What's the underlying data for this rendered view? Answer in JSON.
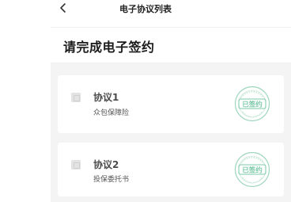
{
  "navbar": {
    "title": "电子协议列表",
    "back_icon": "chevron-left-icon"
  },
  "heading": "请完成电子签约",
  "agreements": [
    {
      "title": "协议1",
      "subtitle": "众包保障险",
      "stamp_text": "已签约",
      "signed": true
    },
    {
      "title": "协议2",
      "subtitle": "投保委托书",
      "stamp_text": "已签约",
      "signed": true
    }
  ],
  "colors": {
    "stamp": "#7cc9a8",
    "card_bg": "#ffffff",
    "content_bg": "#f4f4f4"
  }
}
